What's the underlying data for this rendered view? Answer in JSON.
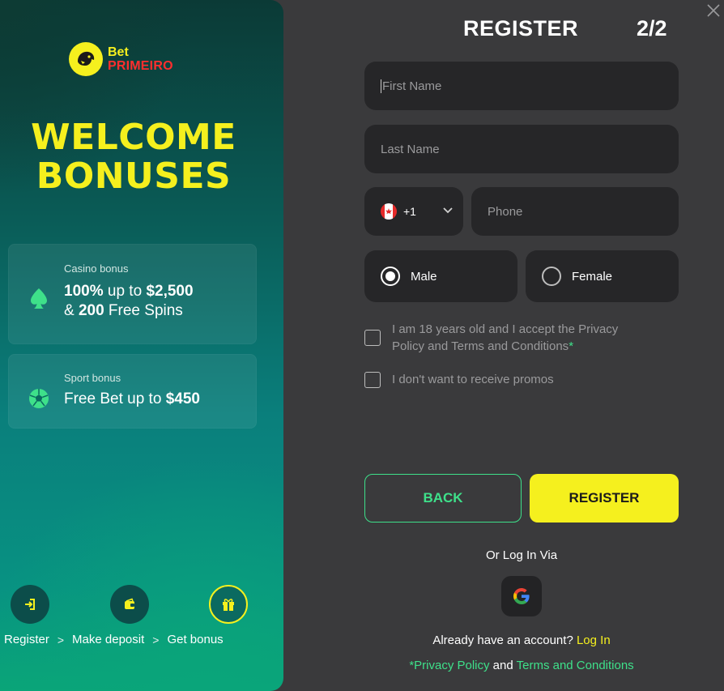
{
  "brand": {
    "logo_line1": "Bet",
    "logo_line2": "PRIMEIRO"
  },
  "promo": {
    "headline_line1": "WELCOME",
    "headline_line2": "BONUSES",
    "casino": {
      "caption": "Casino bonus",
      "percent": "100%",
      "up_to": " up to ",
      "amount": "$2,500",
      "and": "& ",
      "spins_count": "200",
      "spins_label": " Free Spins",
      "icon": "spade-icon"
    },
    "sport": {
      "caption": "Sport bonus",
      "prefix": "Free Bet up to ",
      "amount": "$450",
      "icon": "soccer-ball-icon"
    },
    "steps": [
      {
        "label": "Register",
        "icon": "login-icon"
      },
      {
        "label": "Make deposit",
        "icon": "wallet-icon"
      },
      {
        "label": "Get bonus",
        "icon": "gift-icon"
      }
    ],
    "step_separator": ">"
  },
  "form": {
    "title": "REGISTER",
    "step": "2/2",
    "first_name_placeholder": "First Name",
    "last_name_placeholder": "Last Name",
    "country_code": "+1",
    "phone_placeholder": "Phone",
    "gender": {
      "male": "Male",
      "female": "Female",
      "selected": "Male"
    },
    "terms_text": "I am 18 years old and I accept the Privacy Policy and Terms and Conditions",
    "terms_required_mark": "*",
    "promos_text": "I don't want to receive promos",
    "back_label": "BACK",
    "register_label": "REGISTER",
    "or_login_via": "Or Log In Via",
    "already_text": "Already have an account? ",
    "login_link": "Log In",
    "legal_privacy": "*Privacy Policy",
    "legal_and": " and ",
    "legal_terms": "Terms and Conditions"
  },
  "colors": {
    "accent_yellow": "#f5f01e",
    "accent_green": "#3ee08a",
    "brand_red": "#ff2e2e",
    "background": "#3a3a3c",
    "field_bg": "#262628"
  }
}
